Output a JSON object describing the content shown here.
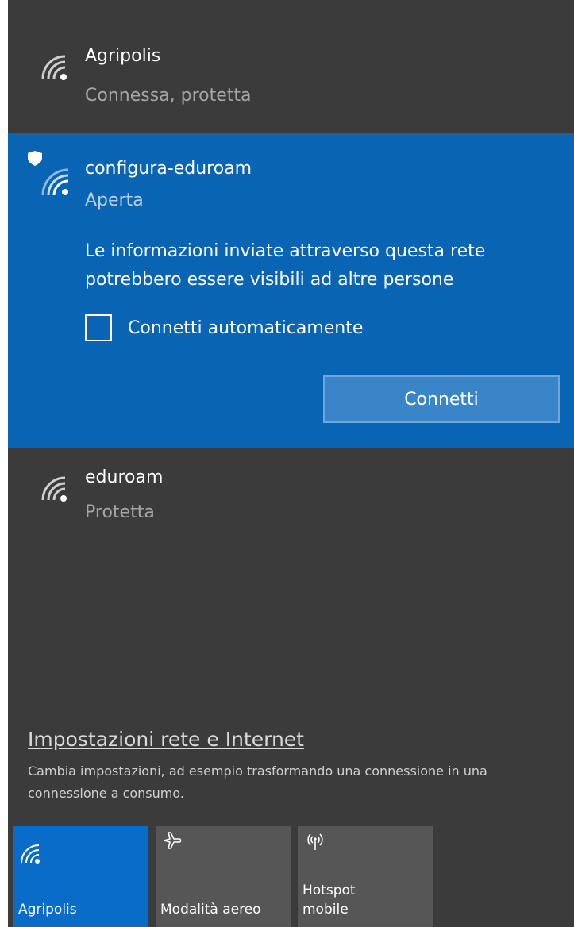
{
  "networks": [
    {
      "name": "Agripolis",
      "status": "Connessa, protetta",
      "icon": "wifi-secure-icon"
    },
    {
      "name": "configura-eduroam",
      "status": "Aperta",
      "icon": "wifi-open-shield-icon",
      "warning_line1": "Le informazioni inviate attraverso questa rete",
      "warning_line2": "potrebbero essere visibili ad altre persone",
      "auto_connect_label": "Connetti automaticamente",
      "auto_connect_checked": false,
      "connect_button": "Connetti"
    },
    {
      "name": "eduroam",
      "status": "Protetta",
      "icon": "wifi-secure-icon"
    }
  ],
  "settings": {
    "link": "Impostazioni rete e Internet",
    "description": "Cambia impostazioni, ad esempio trasformando una connessione in una connessione a consumo."
  },
  "quick_actions": [
    {
      "label": "Agripolis",
      "icon": "wifi-icon",
      "active": true
    },
    {
      "label": "Modalità aereo",
      "icon": "airplane-icon",
      "active": false
    },
    {
      "label_line1": "Hotspot",
      "label_line2": "mobile",
      "icon": "hotspot-icon",
      "active": false
    }
  ],
  "colors": {
    "panel_background": "#3b3b3b",
    "selected_background": "#0a64b4",
    "accent_tile": "#0a6cc9",
    "inactive_tile": "#565656"
  }
}
